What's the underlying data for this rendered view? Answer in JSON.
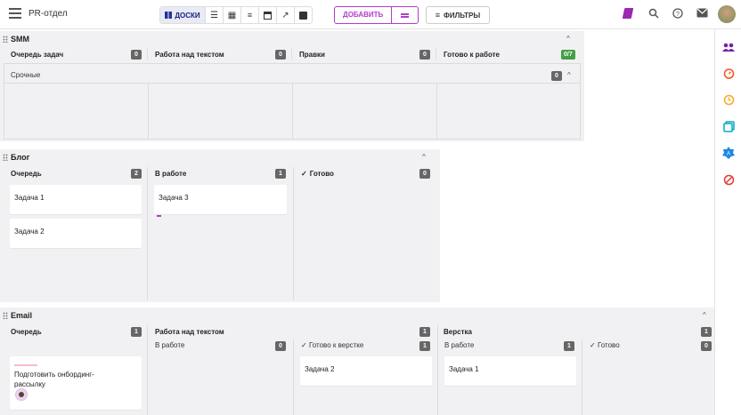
{
  "topbar": {
    "project": "PR-отдел",
    "view_active_label": "ДОСКИ",
    "add_label": "ДОБАВИТЬ",
    "filter_label": "ФИЛЬТРЫ"
  },
  "boards": {
    "smm": {
      "title": "SMM",
      "columns": [
        {
          "label": "Очередь задач",
          "count": "0"
        },
        {
          "label": "Работа над текстом",
          "count": "0"
        },
        {
          "label": "Правки",
          "count": "0"
        },
        {
          "label": "Готово к работе",
          "count": "0/7"
        }
      ],
      "swimlane": {
        "label": "Срочные",
        "count": "0"
      }
    },
    "blog": {
      "title": "Блог",
      "columns": [
        {
          "label": "Очередь",
          "count": "2"
        },
        {
          "label": "В работе",
          "count": "1"
        },
        {
          "label": "Готово",
          "count": "0"
        }
      ],
      "cards": {
        "c1": "Задача 1",
        "c2": "Задача 2",
        "c3": "Задача 3"
      }
    },
    "email": {
      "title": "Email",
      "columns": [
        {
          "label": "Очередь",
          "count": "1"
        },
        {
          "label": "Работа над текстом",
          "count": "1"
        },
        {
          "label": "Верстка",
          "count": "1"
        }
      ],
      "subcolumns": [
        {
          "label": "В работе",
          "count": "0"
        },
        {
          "label": "Готово к верстке",
          "count": "1"
        },
        {
          "label": "В работе",
          "count": "1"
        },
        {
          "label": "Готово",
          "count": "0"
        }
      ],
      "cards": {
        "c1": "Подготовить онбординг-рассылку",
        "c2": "Задача 2",
        "c3": "Задача 1"
      }
    }
  },
  "colors": {
    "accent": "#b13ec8",
    "done_badge": "#43a047",
    "board_bg": "#f1f1f3"
  }
}
